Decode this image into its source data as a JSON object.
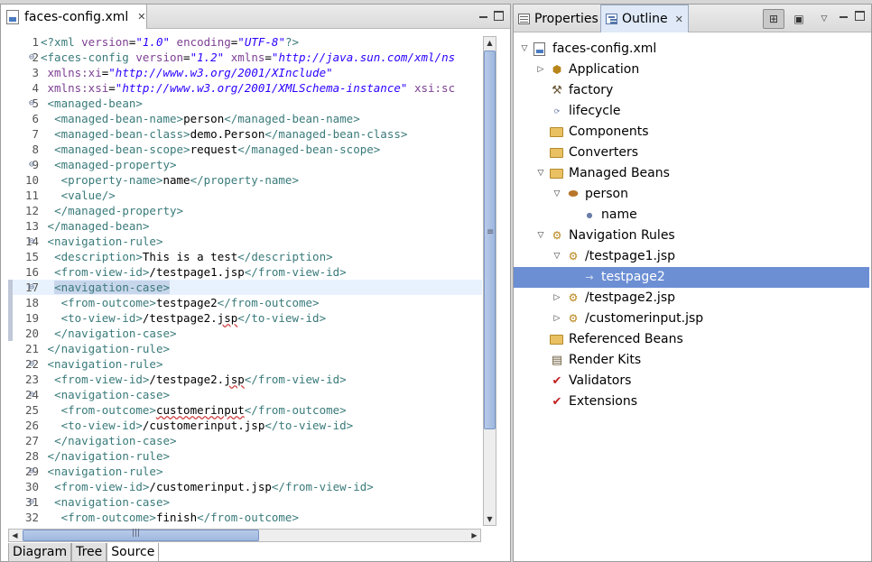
{
  "editor": {
    "tab_title": "faces-config.xml",
    "bottom_tabs": [
      "Diagram",
      "Tree",
      "Source"
    ],
    "active_bottom_tab": "Source",
    "lines": [
      {
        "n": "1",
        "fold": "",
        "html": "<span class='t-pi'>&lt;?xml </span><span class='t-attr'>version</span>=<span class='t-str'>\"1.0\"</span> <span class='t-attr'>encoding</span>=<span class='t-str'>\"UTF-8\"</span><span class='t-pi'>?&gt;</span>"
      },
      {
        "n": "2",
        "fold": "⊖",
        "html": "<span class='t-tag'>&lt;faces-config </span><span class='t-attr'>version</span>=<span class='t-str'>\"1.2\"</span> <span class='t-attr'>xmlns</span>=<span class='t-str'>\"http://java.sun.com/xml/ns</span>"
      },
      {
        "n": "3",
        "fold": "",
        "html": " <span class='t-attr'>xmlns:xi</span>=<span class='t-str'>\"http://www.w3.org/2001/XInclude\"</span>"
      },
      {
        "n": "4",
        "fold": "",
        "html": " <span class='t-attr'>xmlns:xsi</span>=<span class='t-str'>\"http://www.w3.org/2001/XMLSchema-instance\"</span> <span class='t-attr'>xsi:sc</span>"
      },
      {
        "n": "5",
        "fold": "⊖",
        "html": " <span class='t-tag'>&lt;managed-bean&gt;</span>"
      },
      {
        "n": "6",
        "fold": "",
        "html": "  <span class='t-tag'>&lt;managed-bean-name&gt;</span>person<span class='t-tag'>&lt;/managed-bean-name&gt;</span>"
      },
      {
        "n": "7",
        "fold": "",
        "html": "  <span class='t-tag'>&lt;managed-bean-class&gt;</span>demo.Person<span class='t-tag'>&lt;/managed-bean-class&gt;</span>"
      },
      {
        "n": "8",
        "fold": "",
        "html": "  <span class='t-tag'>&lt;managed-bean-scope&gt;</span>request<span class='t-tag'>&lt;/managed-bean-scope&gt;</span>"
      },
      {
        "n": "9",
        "fold": "⊖",
        "html": "  <span class='t-tag'>&lt;managed-property&gt;</span>"
      },
      {
        "n": "10",
        "fold": "",
        "html": "   <span class='t-tag'>&lt;property-name&gt;</span>name<span class='t-tag'>&lt;/property-name&gt;</span>"
      },
      {
        "n": "11",
        "fold": "",
        "html": "   <span class='t-tag'>&lt;value/&gt;</span>"
      },
      {
        "n": "12",
        "fold": "",
        "html": "  <span class='t-tag'>&lt;/managed-property&gt;</span>"
      },
      {
        "n": "13",
        "fold": "",
        "html": " <span class='t-tag'>&lt;/managed-bean&gt;</span>"
      },
      {
        "n": "14",
        "fold": "⊖",
        "html": " <span class='t-tag'>&lt;navigation-rule&gt;</span>"
      },
      {
        "n": "15",
        "fold": "",
        "html": "  <span class='t-tag'>&lt;description&gt;</span>This is a test<span class='t-tag'>&lt;/description&gt;</span>"
      },
      {
        "n": "16",
        "fold": "",
        "html": "  <span class='t-tag'>&lt;from-view-id&gt;</span>/testpage1.jsp<span class='t-tag'>&lt;/from-view-id&gt;</span>"
      },
      {
        "n": "17",
        "fold": "⊖",
        "current": true,
        "html": "  <span class='sel-tag'>&lt;navigation-case&gt;</span>"
      },
      {
        "n": "18",
        "fold": "",
        "mark": true,
        "html": "   <span class='t-tag'>&lt;from-outcome&gt;</span>testpage2<span class='t-tag'>&lt;/from-outcome&gt;</span>"
      },
      {
        "n": "19",
        "fold": "",
        "mark": true,
        "html": "   <span class='t-tag'>&lt;to-view-id&gt;</span>/testpage2.<span class='squiggle'>jsp</span><span class='t-tag'>&lt;/to-view-id&gt;</span>"
      },
      {
        "n": "20",
        "fold": "",
        "mark": true,
        "html": "  <span class='t-tag'>&lt;/navigation-case&gt;</span>"
      },
      {
        "n": "21",
        "fold": "",
        "html": " <span class='t-tag'>&lt;/navigation-rule&gt;</span>"
      },
      {
        "n": "22",
        "fold": "⊖",
        "html": " <span class='t-tag'>&lt;navigation-rule&gt;</span>"
      },
      {
        "n": "23",
        "fold": "",
        "html": "  <span class='t-tag'>&lt;from-view-id&gt;</span>/testpage2.<span class='squiggle'>jsp</span><span class='t-tag'>&lt;/from-view-id&gt;</span>"
      },
      {
        "n": "24",
        "fold": "⊖",
        "html": "  <span class='t-tag'>&lt;navigation-case&gt;</span>"
      },
      {
        "n": "25",
        "fold": "",
        "html": "   <span class='t-tag'>&lt;from-outcome&gt;</span><span class='squiggle'>customerinput</span><span class='t-tag'>&lt;/from-outcome&gt;</span>"
      },
      {
        "n": "26",
        "fold": "",
        "html": "   <span class='t-tag'>&lt;to-view-id&gt;</span>/customerinput.jsp<span class='t-tag'>&lt;/to-view-id&gt;</span>"
      },
      {
        "n": "27",
        "fold": "",
        "html": "  <span class='t-tag'>&lt;/navigation-case&gt;</span>"
      },
      {
        "n": "28",
        "fold": "",
        "html": " <span class='t-tag'>&lt;/navigation-rule&gt;</span>"
      },
      {
        "n": "29",
        "fold": "⊖",
        "html": " <span class='t-tag'>&lt;navigation-rule&gt;</span>"
      },
      {
        "n": "30",
        "fold": "",
        "html": "  <span class='t-tag'>&lt;from-view-id&gt;</span>/customerinput.jsp<span class='t-tag'>&lt;/from-view-id&gt;</span>"
      },
      {
        "n": "31",
        "fold": "⊖",
        "html": "  <span class='t-tag'>&lt;navigation-case&gt;</span>"
      },
      {
        "n": "32",
        "fold": "",
        "html": "   <span class='t-tag'>&lt;from-outcome&gt;</span>finish<span class='t-tag'>&lt;/from-outcome&gt;</span>"
      }
    ]
  },
  "outline_pane": {
    "tabs": {
      "properties": "Properties",
      "outline": "Outline"
    },
    "tree": [
      {
        "label": "faces-config.xml",
        "depth": 0,
        "twisty": "▽",
        "icon": "xml-file-icon"
      },
      {
        "label": "Application",
        "depth": 1,
        "twisty": "▷",
        "icon": "application-icon"
      },
      {
        "label": "factory",
        "depth": 1,
        "twisty": "",
        "icon": "factory-icon"
      },
      {
        "label": "lifecycle",
        "depth": 1,
        "twisty": "",
        "icon": "lifecycle-icon"
      },
      {
        "label": "Components",
        "depth": 1,
        "twisty": "",
        "icon": "folder-icon"
      },
      {
        "label": "Converters",
        "depth": 1,
        "twisty": "",
        "icon": "folder-icon"
      },
      {
        "label": "Managed Beans",
        "depth": 1,
        "twisty": "▽",
        "icon": "folder-icon"
      },
      {
        "label": "person",
        "depth": 2,
        "twisty": "▽",
        "icon": "bean-icon"
      },
      {
        "label": "name",
        "depth": 3,
        "twisty": "",
        "icon": "property-icon"
      },
      {
        "label": "Navigation Rules",
        "depth": 1,
        "twisty": "▽",
        "icon": "gear-folder-icon"
      },
      {
        "label": "/testpage1.jsp",
        "depth": 2,
        "twisty": "▽",
        "icon": "gear-icon"
      },
      {
        "label": "testpage2",
        "depth": 3,
        "twisty": "",
        "icon": "nav-case-icon",
        "selected": true
      },
      {
        "label": "/testpage2.jsp",
        "depth": 2,
        "twisty": "▷",
        "icon": "gear-icon"
      },
      {
        "label": "/customerinput.jsp",
        "depth": 2,
        "twisty": "▷",
        "icon": "gear-icon"
      },
      {
        "label": "Referenced Beans",
        "depth": 1,
        "twisty": "",
        "icon": "folder-icon"
      },
      {
        "label": "Render Kits",
        "depth": 1,
        "twisty": "",
        "icon": "render-kit-icon"
      },
      {
        "label": "Validators",
        "depth": 1,
        "twisty": "",
        "icon": "check-icon"
      },
      {
        "label": "Extensions",
        "depth": 1,
        "twisty": "",
        "icon": "check-icon"
      }
    ]
  },
  "colors": {
    "selection": "#6c8fd4",
    "current_line": "#e8f2fe",
    "tag": "#3a7a7a",
    "attr": "#7d3f93",
    "string": "#2a00ff"
  }
}
